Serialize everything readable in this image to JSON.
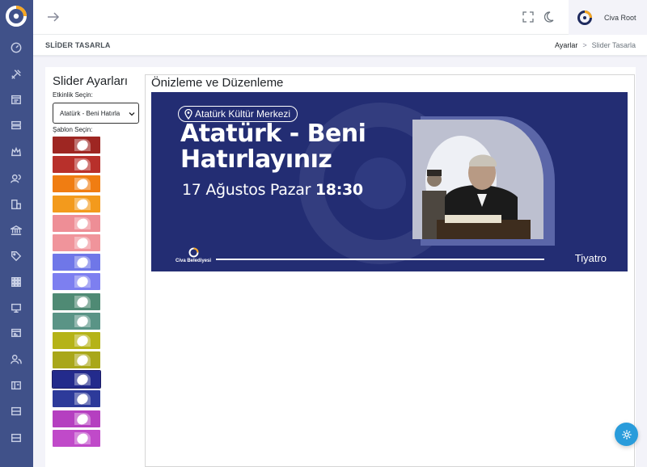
{
  "app": {
    "user_name": "Civa Root"
  },
  "page": {
    "title": "SLİDER TASARLA",
    "breadcrumb": {
      "parent": "Ayarlar",
      "separator": ">",
      "current": "Slider Tasarla"
    }
  },
  "settings": {
    "title": "Slider Ayarları",
    "event_label": "Etkinlik Seçin:",
    "event_selected": "Atatürk - Beni Hatırla",
    "template_label": "Şablon Seçin:",
    "templates": [
      {
        "color": "#9e2622"
      },
      {
        "color": "#b8302b"
      },
      {
        "color": "#f07d12"
      },
      {
        "color": "#f39a1c"
      },
      {
        "color": "#ee8e96"
      },
      {
        "color": "#f0949b"
      },
      {
        "color": "#6f77e8"
      },
      {
        "color": "#7d7ff0"
      },
      {
        "color": "#4f8a74"
      },
      {
        "color": "#5a9486"
      },
      {
        "color": "#b5b318"
      },
      {
        "color": "#a9a71a"
      },
      {
        "color": "#232b8c",
        "selected": true
      },
      {
        "color": "#2d3a9a"
      },
      {
        "color": "#b53fc0"
      },
      {
        "color": "#c04ac9"
      }
    ]
  },
  "preview": {
    "title": "Önizleme ve Düzenleme",
    "banner": {
      "background": "#232d73",
      "location": "Atatürk Kültür Merkezi",
      "event_title": "Atatürk - Beni Hatırlayınız",
      "date": "17 Ağustos Pazar",
      "time": "18:30",
      "municipality": "Civa Belediyesi",
      "category": "Tiyatro"
    }
  },
  "colors": {
    "sidebar": "#405189",
    "accent": "#f5a623",
    "fab": "#299cdb"
  },
  "icons": {
    "sidebar": [
      "dashboard-icon",
      "tools-icon",
      "calendar-icon",
      "server-icon",
      "crown-icon",
      "users-icon",
      "building-icon",
      "bank-icon",
      "tag-icon",
      "grid-icon",
      "presentation-icon",
      "browser-icon",
      "people-icon",
      "ticket-icon",
      "slider-icon",
      "layers-icon"
    ]
  }
}
